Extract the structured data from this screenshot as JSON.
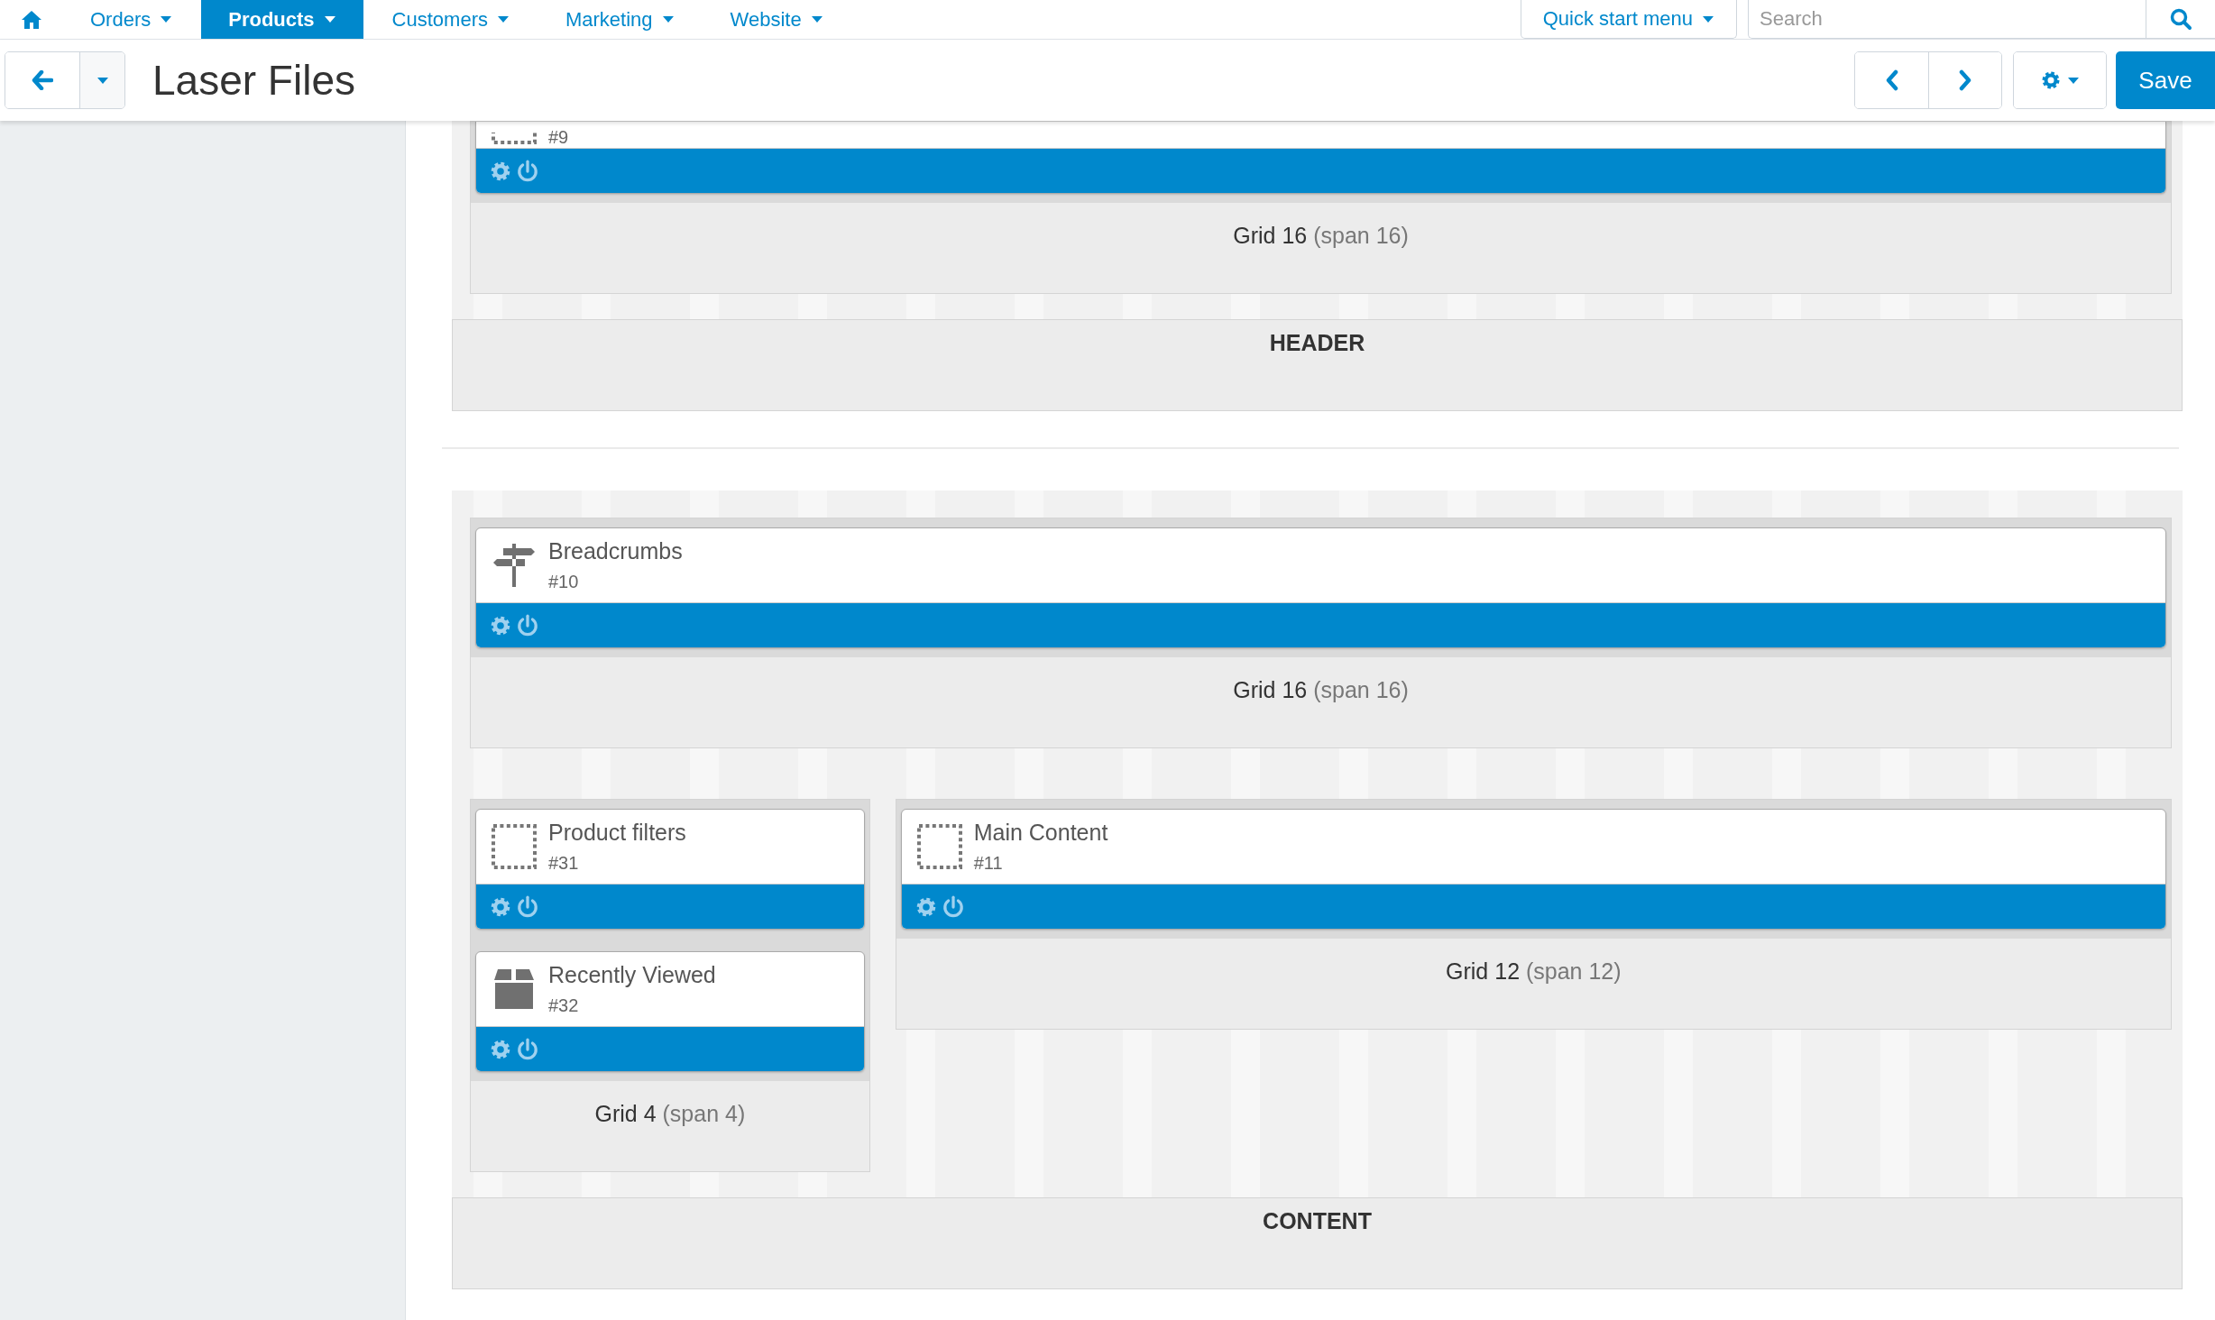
{
  "top_nav": {
    "items": [
      {
        "label": "Orders",
        "selected": false
      },
      {
        "label": "Products",
        "selected": true
      },
      {
        "label": "Customers",
        "selected": false
      },
      {
        "label": "Marketing",
        "selected": false
      },
      {
        "label": "Website",
        "selected": false
      }
    ],
    "quick_start": "Quick start menu",
    "search": {
      "placeholder": "Search"
    }
  },
  "toolbar": {
    "title": "Laser Files",
    "save": "Save"
  },
  "sections": [
    {
      "title": "HEADER",
      "cut_top": true,
      "rows": [
        {
          "grids": [
            {
              "kind": "full",
              "name": "Grid 16",
              "span": "(span 16)",
              "blocks": [
                {
                  "kind": "placeholder",
                  "number": "#9"
                }
              ]
            }
          ]
        }
      ]
    },
    {
      "title": "CONTENT",
      "cut_top": false,
      "rows": [
        {
          "grids": [
            {
              "kind": "full",
              "name": "Grid 16",
              "span": "(span 16)",
              "blocks": [
                {
                  "kind": "signpost",
                  "title": "Breadcrumbs",
                  "number": "#10"
                }
              ]
            }
          ]
        },
        {
          "grids": [
            {
              "kind": "narrow",
              "name": "Grid 4",
              "span": "(span 4)",
              "blocks": [
                {
                  "kind": "placeholder",
                  "title": "Product filters",
                  "number": "#31"
                },
                {
                  "kind": "box",
                  "title": "Recently Viewed",
                  "number": "#32"
                }
              ]
            },
            {
              "kind": "wide",
              "name": "Grid 12",
              "span": "(span 12)",
              "blocks": [
                {
                  "kind": "placeholder",
                  "title": "Main Content",
                  "number": "#11"
                }
              ]
            }
          ]
        }
      ]
    }
  ]
}
